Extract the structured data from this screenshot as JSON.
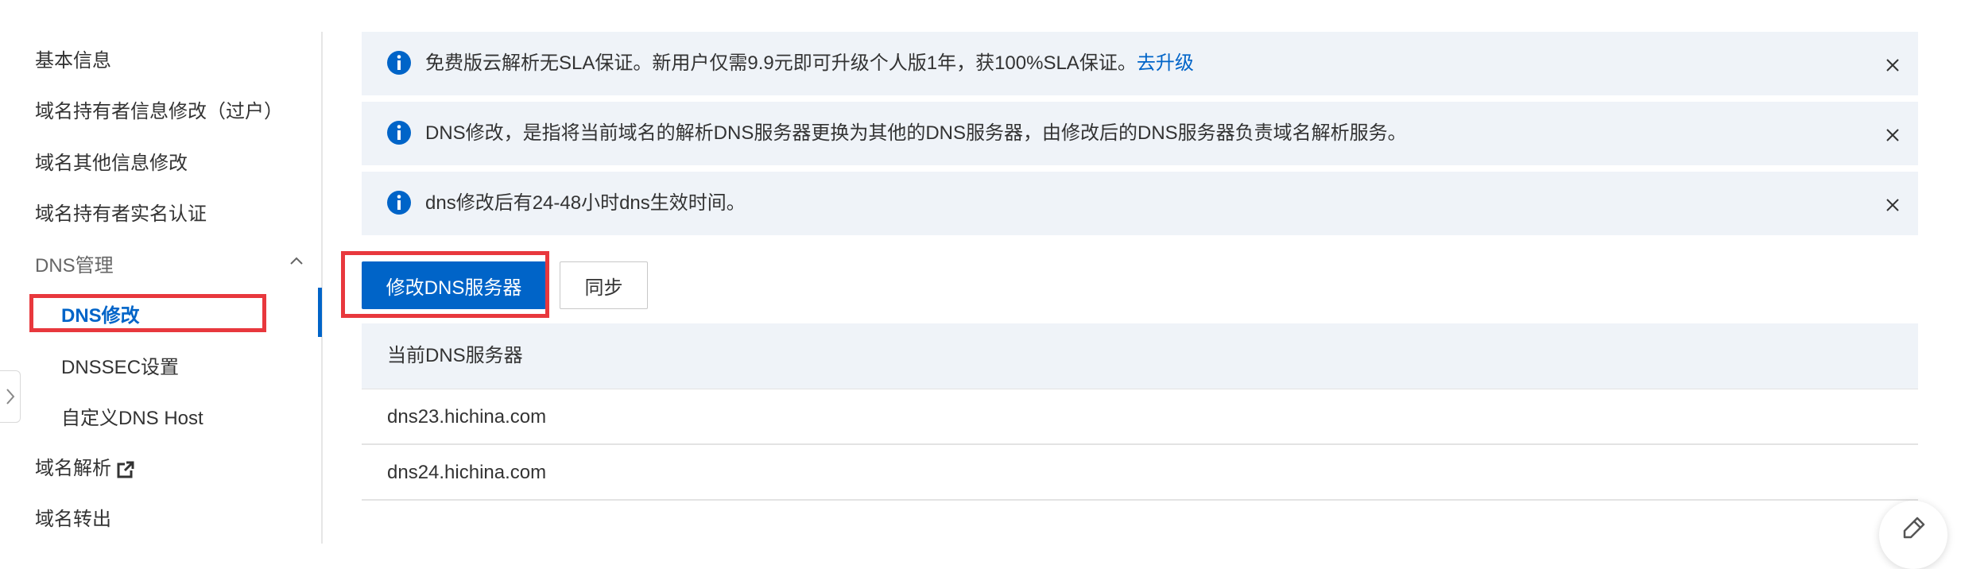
{
  "sidebar": {
    "items": [
      {
        "label": "基本信息"
      },
      {
        "label": "域名持有者信息修改（过户）"
      },
      {
        "label": "域名其他信息修改"
      },
      {
        "label": "域名持有者实名认证"
      },
      {
        "label": "DNS管理",
        "expanded": true
      },
      {
        "label": "DNS修改",
        "active": true
      },
      {
        "label": "DNSSEC设置"
      },
      {
        "label": "自定义DNS Host"
      },
      {
        "label": "域名解析",
        "icon": "external-link-icon"
      },
      {
        "label": "域名转出"
      }
    ]
  },
  "alerts": [
    {
      "text": "免费版云解析无SLA保证。新用户仅需9.9元即可升级个人版1年，获100%SLA保证。",
      "link": "去升级",
      "icon": "info-icon"
    },
    {
      "text": "DNS修改，是指将当前域名的解析DNS服务器更换为其他的DNS服务器，由修改后的DNS服务器负责域名解析服务。",
      "icon": "info-icon"
    },
    {
      "text": "dns修改后有24-48小时dns生效时间。",
      "icon": "info-icon"
    }
  ],
  "actions": {
    "modify_label": "修改DNS服务器",
    "sync_label": "同步"
  },
  "table": {
    "header": "当前DNS服务器",
    "rows": [
      "dns23.hichina.com",
      "dns24.hichina.com"
    ]
  },
  "colors": {
    "accent": "#0064c8",
    "highlight": "#e8383d",
    "alert_bg": "#eff3f8"
  }
}
